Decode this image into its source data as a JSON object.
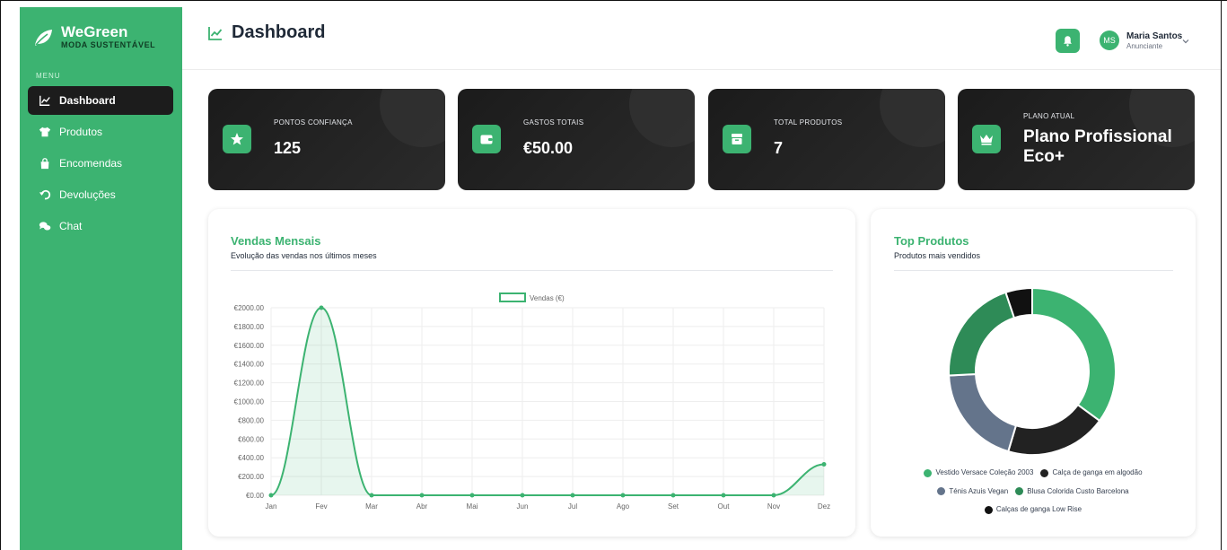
{
  "brand": {
    "name": "WeGreen",
    "tagline": "MODA SUSTENTÁVEL"
  },
  "sidebar": {
    "menu_label": "MENU",
    "items": [
      {
        "label": "Dashboard",
        "icon": "chart-line-icon",
        "active": true
      },
      {
        "label": "Produtos",
        "icon": "tshirt-icon",
        "active": false
      },
      {
        "label": "Encomendas",
        "icon": "shopping-bag-icon",
        "active": false
      },
      {
        "label": "Devoluções",
        "icon": "undo-icon",
        "active": false
      },
      {
        "label": "Chat",
        "icon": "comments-icon",
        "active": false
      }
    ]
  },
  "header": {
    "title": "Dashboard",
    "user": {
      "initials": "MS",
      "name": "Maria Santos",
      "role": "Anunciante"
    }
  },
  "stats": [
    {
      "label": "PONTOS CONFIANÇA",
      "value": "125",
      "icon": "star-icon"
    },
    {
      "label": "GASTOS TOTAIS",
      "value": "€50.00",
      "icon": "wallet-icon"
    },
    {
      "label": "TOTAL PRODUTOS",
      "value": "7",
      "icon": "box-icon"
    },
    {
      "label": "PLANO ATUAL",
      "value": "Plano Profissional Eco+",
      "icon": "crown-icon"
    }
  ],
  "sales_panel": {
    "title": "Vendas Mensais",
    "subtitle": "Evolução das vendas nos últimos meses"
  },
  "top_panel": {
    "title": "Top Produtos",
    "subtitle": "Produtos mais vendidos"
  },
  "colors": {
    "accent": "#3cb371",
    "dark": "#1c1c1c",
    "slate": "#64748b",
    "forest": "#2e8b57"
  },
  "chart_data": [
    {
      "type": "line",
      "title": "",
      "xlabel": "",
      "ylabel": "",
      "categories": [
        "Jan",
        "Fev",
        "Mar",
        "Abr",
        "Mai",
        "Jun",
        "Jul",
        "Ago",
        "Set",
        "Out",
        "Nov",
        "Dez"
      ],
      "series": [
        {
          "name": "Vendas (€)",
          "values": [
            0,
            2000,
            0,
            0,
            0,
            0,
            0,
            0,
            0,
            0,
            0,
            330
          ]
        }
      ],
      "ylim": [
        0,
        2000
      ],
      "yticks": [
        "€0.00",
        "€200.00",
        "€400.00",
        "€600.00",
        "€800.00",
        "€1000.00",
        "€1200.00",
        "€1400.00",
        "€1600.00",
        "€1800.00",
        "€2000.00"
      ],
      "legend": "top-center",
      "grid": true,
      "fill": true
    },
    {
      "type": "pie",
      "variant": "doughnut",
      "labels": [
        "Vestido Versace Coleção 2003",
        "Calça de ganga em algodão",
        "Ténis Azuis Vegan",
        "Blusa Colorida Custo Barcelona",
        "Calças de ganga Low Rise"
      ],
      "values": [
        34,
        19,
        19,
        20,
        5
      ],
      "colors": [
        "#3cb371",
        "#222222",
        "#64748b",
        "#2e8b57",
        "#111111"
      ],
      "legend": "bottom"
    }
  ]
}
